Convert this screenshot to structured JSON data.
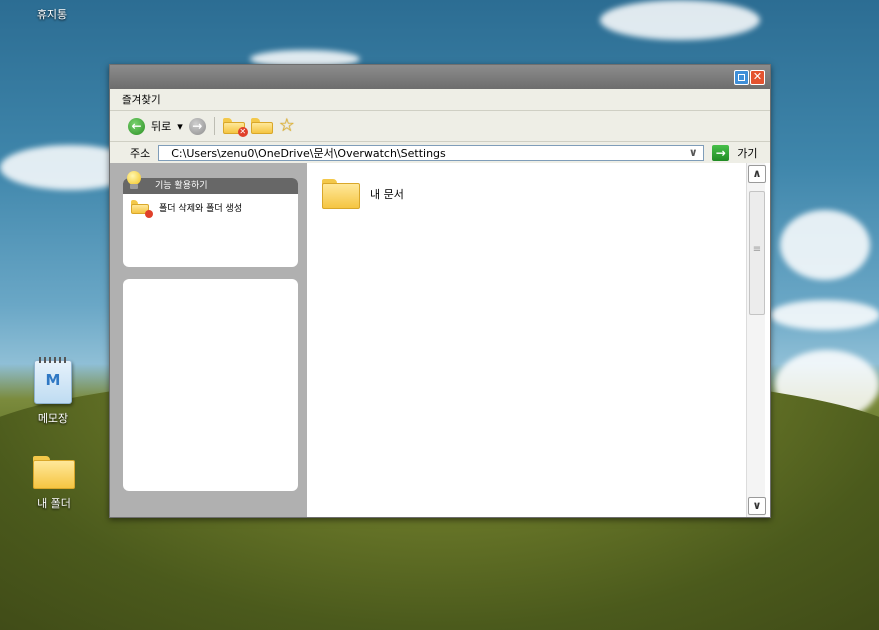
{
  "desktop": {
    "icons": [
      {
        "label": "휴지통"
      },
      {
        "label": "메모장",
        "glyph": "M"
      },
      {
        "label": "내 폴더"
      }
    ]
  },
  "window": {
    "menubar": {
      "item": "즐겨찾기"
    },
    "toolbar": {
      "back_label": "뒤로",
      "back_dropdown": "▾"
    },
    "address": {
      "label": "주소",
      "path": "C:\\Users\\zenu0\\OneDrive\\문서\\Overwatch\\Settings",
      "go_label": "가기"
    },
    "task_panel": {
      "title": "기능 활용하기",
      "task": "폴더 삭제와 폴더 생성"
    },
    "files": [
      {
        "name": "내 문서",
        "type": "folder"
      }
    ]
  }
}
